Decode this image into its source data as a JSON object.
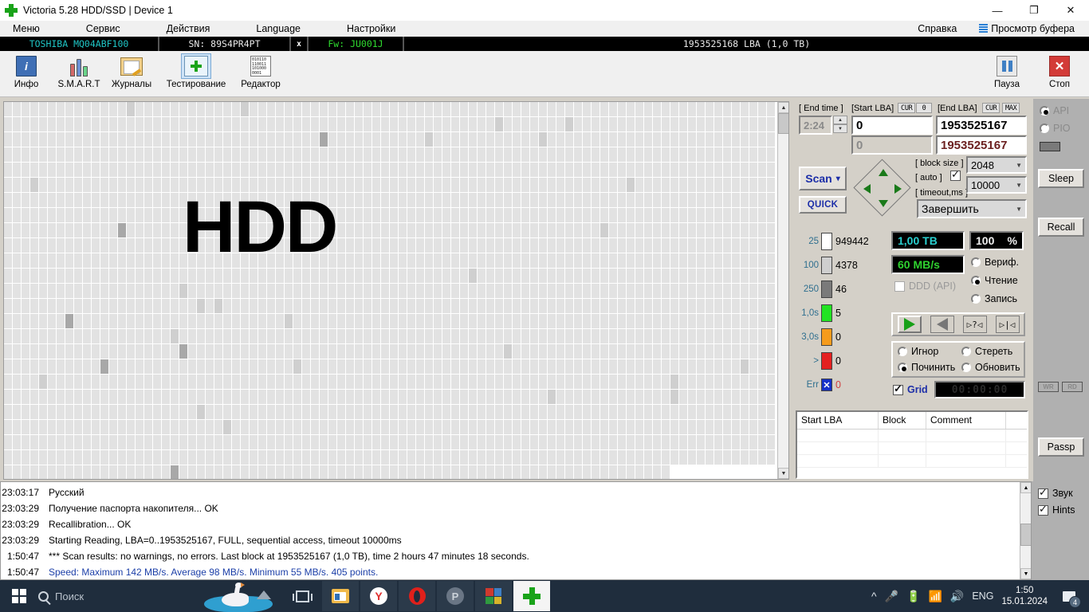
{
  "window": {
    "title": "Victoria 5.28 HDD/SSD | Device 1",
    "app_icon": "green-cross-icon",
    "minimize": "—",
    "maximize": "❐",
    "close": "✕"
  },
  "menu": {
    "items": [
      "Меню",
      "Сервис",
      "Действия",
      "Language",
      "Настройки"
    ],
    "help": "Справка",
    "buffer_view": "Просмотр буфера"
  },
  "device_bar": {
    "model": "TOSHIBA MQ04ABF100",
    "serial": "SN: 89S4PR4PT",
    "close_x": "x",
    "firmware": "Fw: JU001J",
    "capacity": "1953525168 LBA (1,0 TB)"
  },
  "toolbar": {
    "buttons": [
      {
        "label": "Инфо",
        "icon": "info-icon"
      },
      {
        "label": "S.M.A.R.T",
        "icon": "smart-chart-icon"
      },
      {
        "label": "Журналы",
        "icon": "logs-folder-icon"
      },
      {
        "label": "Тестирование",
        "icon": "testing-cross-icon"
      },
      {
        "label": "Редактор",
        "icon": "editor-binary-icon"
      }
    ],
    "pause": {
      "label": "Пауза",
      "icon": "pause-icon"
    },
    "stop": {
      "label": "Стоп",
      "icon": "stop-x-icon"
    }
  },
  "map": {
    "overlay_text": "HDD"
  },
  "scan": {
    "end_time_label": "[ End time ]",
    "end_time_value": "2:24",
    "start_lba_label": "[Start LBA]",
    "start_lba_cur": "CUR",
    "start_lba_zero": "0",
    "start_lba_value": "0",
    "start_lba_second": "0",
    "end_lba_label": "[End LBA]",
    "end_lba_cur": "CUR",
    "end_lba_max": "MAX",
    "end_lba_value": "1953525167",
    "end_lba_second": "1953525167",
    "scan_button": "Scan",
    "scan_caret": "▾",
    "quick_button": "QUICK",
    "block_size_label": "[ block size ]",
    "block_size_value": "2048",
    "auto_label": "[ auto ]",
    "auto_checked": true,
    "timeout_label": "[ timeout,ms ]",
    "timeout_value": "10000",
    "action_value": "Завершить"
  },
  "stats": [
    {
      "time": "25",
      "color": "#ffffff",
      "count": "949442"
    },
    {
      "time": "100",
      "color": "#cfcfcf",
      "count": "4378"
    },
    {
      "time": "250",
      "color": "#7a7a7a",
      "count": "46"
    },
    {
      "time": "1,0s",
      "color": "#22e322",
      "count": "5"
    },
    {
      "time": "3,0s",
      "color": "#f59b1c",
      "count": "0"
    },
    {
      "time": ">",
      "color": "#e42020",
      "count": "0"
    },
    {
      "time": "Err",
      "color": "#1530c8",
      "count": "0"
    }
  ],
  "readout": {
    "capacity": "1,00 TB",
    "speed": "60 MB/s",
    "percent_value": "100",
    "percent_sign": "%",
    "ddd_label": "DDD (API)",
    "ddd_checked": false,
    "modes": [
      {
        "label": "Вериф.",
        "selected": false
      },
      {
        "label": "Чтение",
        "selected": true
      },
      {
        "label": "Запись",
        "selected": false
      }
    ],
    "transport": [
      {
        "name": "play-forward-button",
        "glyph": "▶"
      },
      {
        "name": "play-backward-button",
        "glyph": "◀"
      },
      {
        "name": "random-read-button",
        "glyph": "▷?◁"
      },
      {
        "name": "butterfly-read-button",
        "glyph": "▷|◁"
      }
    ],
    "defect_actions": [
      {
        "label": "Игнор",
        "selected": false
      },
      {
        "label": "Стереть",
        "selected": false
      },
      {
        "label": "Починить",
        "selected": true
      },
      {
        "label": "Обновить",
        "selected": false
      }
    ],
    "grid_label": "Grid",
    "grid_checked": true,
    "timer": "00:00:00"
  },
  "defect_table": {
    "columns": [
      "Start LBA",
      "Block",
      "Comment"
    ],
    "rows": []
  },
  "sidebar": {
    "api_label": "API",
    "api_selected": true,
    "pio_label": "PIO",
    "pio_selected": false,
    "sleep": "Sleep",
    "recall": "Recall",
    "wr": "WR",
    "rd": "RD",
    "passp": "Passp",
    "sound_label": "Звук",
    "sound_checked": true,
    "hints_label": "Hints",
    "hints_checked": true
  },
  "log": [
    {
      "time": "23:03:17",
      "text": "Русский",
      "blue": false
    },
    {
      "time": "23:03:29",
      "text": "Получение паспорта накопителя... OK",
      "blue": false
    },
    {
      "time": "23:03:29",
      "text": "Recallibration... OK",
      "blue": false
    },
    {
      "time": "23:03:29",
      "text": "Starting Reading, LBA=0..1953525167, FULL, sequential access, timeout 10000ms",
      "blue": false
    },
    {
      "time": "1:50:47",
      "text": "*** Scan results: no warnings, no errors. Last block at 1953525167 (1,0 TB), time 2 hours 47 minutes 18 seconds.",
      "blue": false
    },
    {
      "time": "1:50:47",
      "text": "Speed: Maximum 142 MB/s. Average 98 MB/s. Minimum 55 MB/s. 405 points.",
      "blue": true
    }
  ],
  "taskbar": {
    "search_placeholder": "Поиск",
    "apps": [
      {
        "name": "file-explorer-icon",
        "glyph": "🗂"
      },
      {
        "name": "yandex-browser-icon",
        "glyph": "Y"
      },
      {
        "name": "opera-browser-icon",
        "glyph": "O"
      },
      {
        "name": "punto-switcher-icon",
        "glyph": "P"
      },
      {
        "name": "winrar-icon",
        "glyph": "▦"
      },
      {
        "name": "victoria-icon",
        "glyph": "✚"
      }
    ],
    "language": "ENG",
    "time": "1:50",
    "date": "15.01.2024",
    "notification_count": "4"
  }
}
